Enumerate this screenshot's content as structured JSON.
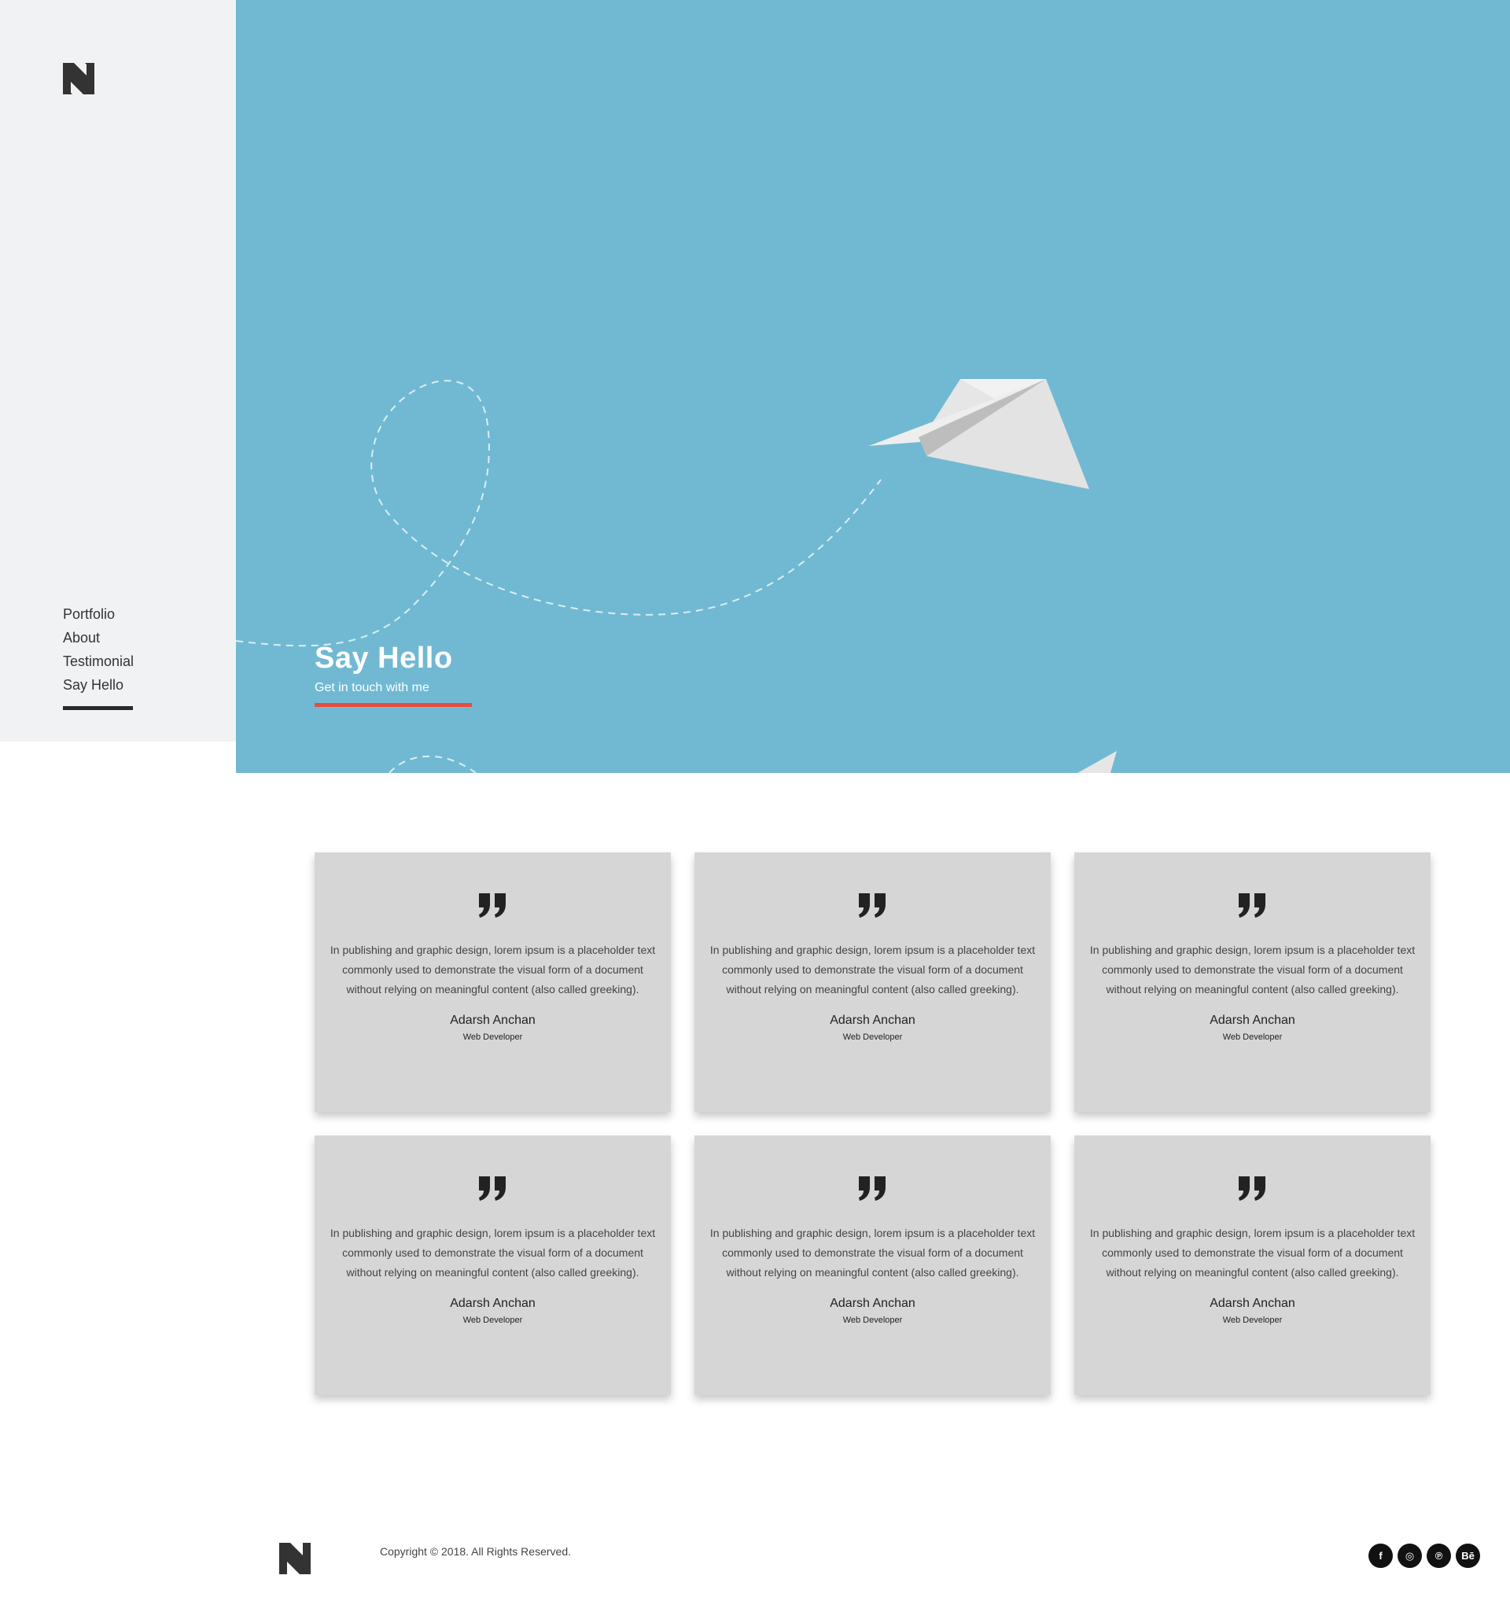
{
  "sidebar": {
    "nav": [
      {
        "label": "Portfolio"
      },
      {
        "label": "About"
      },
      {
        "label": "Testimonial"
      },
      {
        "label": "Say Hello"
      }
    ]
  },
  "hero": {
    "title": "Say Hello",
    "subtitle": "Get in touch with me",
    "background_color": "#71b9d2",
    "accent_color": "#e84c3d"
  },
  "testimonials": [
    {
      "text": "In publishing and graphic design, lorem ipsum is a placeholder text commonly used to demonstrate the visual form of a document without relying on meaningful content (also called greeking).",
      "name": "Adarsh Anchan",
      "role": "Web Developer"
    },
    {
      "text": "In publishing and graphic design, lorem ipsum is a placeholder text commonly used to demonstrate the visual form of a document without relying on meaningful content (also called greeking).",
      "name": "Adarsh Anchan",
      "role": "Web Developer"
    },
    {
      "text": "In publishing and graphic design, lorem ipsum is a placeholder text commonly used to demonstrate the visual form of a document without relying on meaningful content (also called greeking).",
      "name": "Adarsh Anchan",
      "role": "Web Developer"
    },
    {
      "text": "In publishing and graphic design, lorem ipsum is a placeholder text commonly used to demonstrate the visual form of a document without relying on meaningful content (also called greeking).",
      "name": "Adarsh Anchan",
      "role": "Web Developer"
    },
    {
      "text": "In publishing and graphic design, lorem ipsum is a placeholder text commonly used to demonstrate the visual form of a document without relying on meaningful content (also called greeking).",
      "name": "Adarsh Anchan",
      "role": "Web Developer"
    },
    {
      "text": "In publishing and graphic design, lorem ipsum is a placeholder text commonly used to demonstrate the visual form of a document without relying on meaningful content (also called greeking).",
      "name": "Adarsh Anchan",
      "role": "Web Developer"
    }
  ],
  "footer": {
    "copyright": "Copyright © 2018. All Rights Reserved.",
    "socials": [
      {
        "icon": "facebook-icon",
        "glyph": "f"
      },
      {
        "icon": "instagram-icon",
        "glyph": "◎"
      },
      {
        "icon": "pinterest-icon",
        "glyph": "℗"
      },
      {
        "icon": "behance-icon",
        "glyph": "Bē"
      }
    ]
  }
}
